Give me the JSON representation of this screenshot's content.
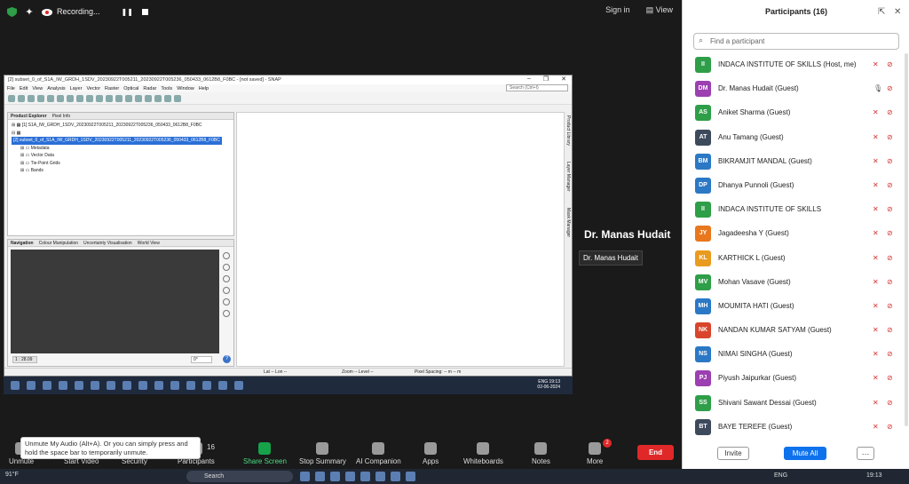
{
  "zoom_top": {
    "recording": "Recording...",
    "sign_in": "Sign in",
    "view": "View"
  },
  "snap": {
    "title": "[2] subset_0_of_S1A_IW_GRDH_1SDV_20230922T005211_20230922T005236_050433_0612B8_F0BC - [not saved] - SNAP",
    "menu": [
      "File",
      "Edit",
      "View",
      "Analysis",
      "Layer",
      "Vector",
      "Raster",
      "Optical",
      "Radar",
      "Tools",
      "Window",
      "Help"
    ],
    "search_placeholder": "Search (Ctrl+I)",
    "pe_tabs": [
      "Product Explorer",
      "Pixel Info"
    ],
    "tree": [
      "[1] S1A_IW_GRDH_1SDV_20230922T005211_20230922T005236_050433_0612B8_F0BC",
      "[2] subset_0_of_S1A_IW_GRDH_1SDV_20230922T005211_20230922T005236_050433_0612B8_F0BC",
      "Metadata",
      "Vector Data",
      "Tie-Point Grids",
      "Bands"
    ],
    "nav_tabs": [
      "Navigation",
      "Colour Manipulation",
      "Uncertainty Visualisation",
      "World View"
    ],
    "scale": "1 : 28.09",
    "degree": "0°",
    "side_tabs": [
      "Product Library",
      "Layer Manager",
      "Mask Manager"
    ],
    "status": {
      "lat": "Lat   -- Lon   --",
      "zoom": "Zoom -- Level --",
      "pixel": "Pixel Spacing: -- m -- m"
    },
    "taskbar": {
      "lang": "ENG",
      "time": "19:13",
      "date": "02-06-2024"
    }
  },
  "speaker": {
    "name": "Dr. Manas Hudait",
    "tooltip": "Dr. Manas Hudait"
  },
  "bottom": {
    "tooltip": "Unmute My Audio (Alt+A). Or you can simply press and hold the space bar to temporarily unmute.",
    "buttons": [
      "Unmute",
      "Start Video",
      "Security",
      "Participants",
      "Share Screen",
      "Stop Summary",
      "AI Companion",
      "Apps",
      "Whiteboards",
      "Notes",
      "More"
    ],
    "participant_count": "16",
    "more_badge": "2",
    "end": "End"
  },
  "panel": {
    "title": "Participants (16)",
    "find": "Find a participant",
    "participants": [
      {
        "initials": "II",
        "name": "INDACA INSTITUTE OF SKILLS (Host, me)",
        "color": "#2e9e48"
      },
      {
        "initials": "DM",
        "name": "Dr. Manas Hudait (Guest)",
        "color": "#9b3fb1"
      },
      {
        "initials": "AS",
        "name": "Aniket Sharma (Guest)",
        "color": "#2e9e48"
      },
      {
        "initials": "AT",
        "name": "Anu Tamang (Guest)",
        "color": "#3d4a5c"
      },
      {
        "initials": "BM",
        "name": "BIKRAMJIT MANDAL (Guest)",
        "color": "#2b78c5"
      },
      {
        "initials": "DP",
        "name": "Dhanya Punnoli (Guest)",
        "color": "#2b78c5"
      },
      {
        "initials": "II",
        "name": "INDACA INSTITUTE OF SKILLS",
        "color": "#2e9e48"
      },
      {
        "initials": "JY",
        "name": "Jagadeesha Y (Guest)",
        "color": "#e8771e"
      },
      {
        "initials": "KL",
        "name": "KARTHICK L (Guest)",
        "color": "#e89b1e"
      },
      {
        "initials": "MV",
        "name": "Mohan Vasave (Guest)",
        "color": "#2e9e48"
      },
      {
        "initials": "MH",
        "name": "MOUMITA HATI (Guest)",
        "color": "#2b78c5"
      },
      {
        "initials": "NK",
        "name": "NANDAN KUMAR SATYAM (Guest)",
        "color": "#d9452b"
      },
      {
        "initials": "NS",
        "name": "NIMAI SINGHA (Guest)",
        "color": "#2b78c5"
      },
      {
        "initials": "PJ",
        "name": "Piyush Jaipurkar (Guest)",
        "color": "#9b3fb1"
      },
      {
        "initials": "SS",
        "name": "Shivani Sawant Dessai (Guest)",
        "color": "#2e9e48"
      },
      {
        "initials": "BT",
        "name": "BAYE TEREFE (Guest)",
        "color": "#3d4a5c"
      }
    ],
    "invite": "Invite",
    "mute_all": "Mute All"
  },
  "os_taskbar": {
    "temp": "91°F",
    "search": "Search",
    "lang": "ENG",
    "time": "19:13",
    "badge": "50"
  }
}
